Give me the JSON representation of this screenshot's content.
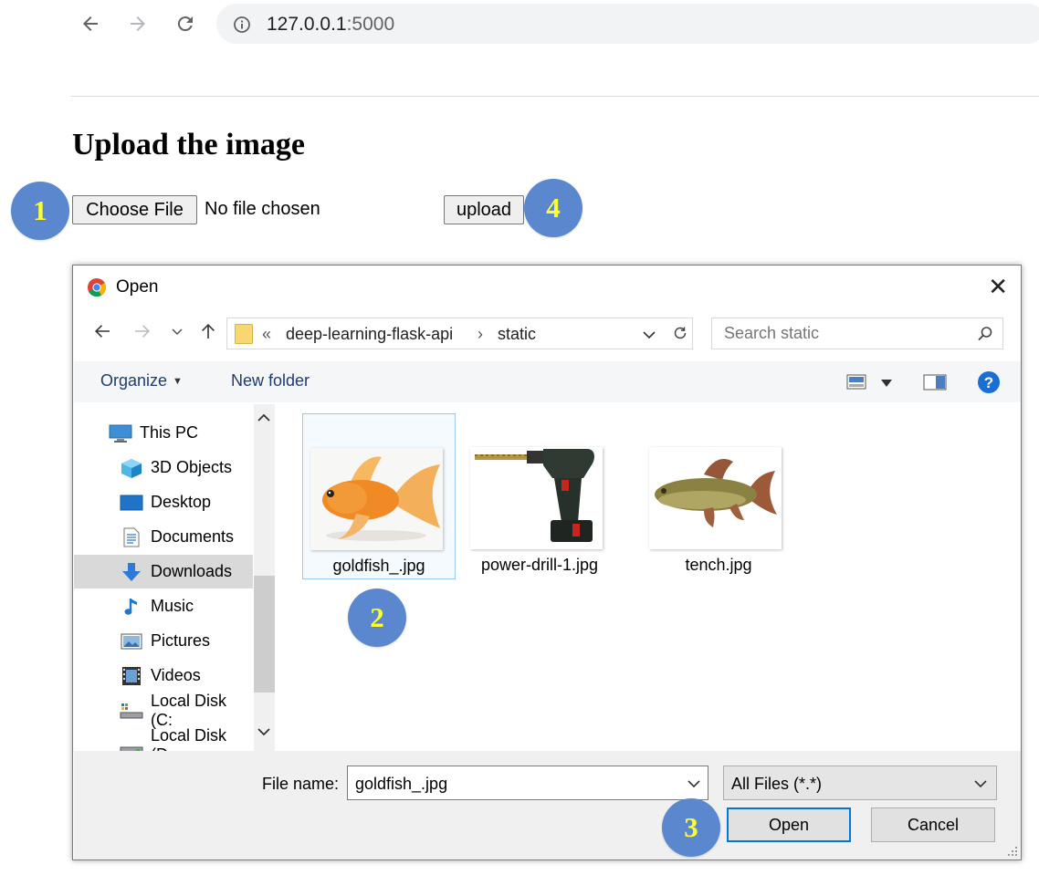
{
  "browser": {
    "url_host": "127.0.0.1",
    "url_port": ":5000"
  },
  "page": {
    "heading": "Upload the image",
    "choose_file_label": "Choose File",
    "no_file_text": "No file chosen",
    "upload_label": "upload"
  },
  "markers": [
    "1",
    "2",
    "3",
    "4"
  ],
  "dialog": {
    "title": "Open",
    "close_glyph": "✕",
    "path": {
      "overflow": "«",
      "segment_1": "deep-learning-flask-api",
      "separator": "›",
      "segment_2": "static"
    },
    "search_placeholder": "Search static",
    "toolbar": {
      "organize": "Organize",
      "new_folder": "New folder"
    },
    "nav_items": [
      {
        "label": "This PC",
        "icon": "computer-icon"
      },
      {
        "label": "3D Objects",
        "icon": "cube-icon"
      },
      {
        "label": "Desktop",
        "icon": "desktop-icon"
      },
      {
        "label": "Documents",
        "icon": "document-icon"
      },
      {
        "label": "Downloads",
        "icon": "download-arrow-icon"
      },
      {
        "label": "Music",
        "icon": "music-note-icon"
      },
      {
        "label": "Pictures",
        "icon": "picture-icon"
      },
      {
        "label": "Videos",
        "icon": "film-icon"
      },
      {
        "label": "Local Disk (C:",
        "icon": "drive-icon"
      },
      {
        "label": "Local Disk (D:",
        "icon": "drive-icon"
      }
    ],
    "files": [
      {
        "name": "goldfish_.jpg",
        "thumb": "goldfish"
      },
      {
        "name": "power-drill-1.jpg",
        "thumb": "drill"
      },
      {
        "name": "tench.jpg",
        "thumb": "tench"
      }
    ],
    "file_name_label": "File name:",
    "file_name_value": "goldfish_.jpg",
    "filter_value": "All Files (*.*)",
    "open_label": "Open",
    "cancel_label": "Cancel"
  },
  "colors": {
    "marker_fill": "#5b87cf",
    "marker_text": "#ffff33",
    "accent": "#0078d7"
  }
}
